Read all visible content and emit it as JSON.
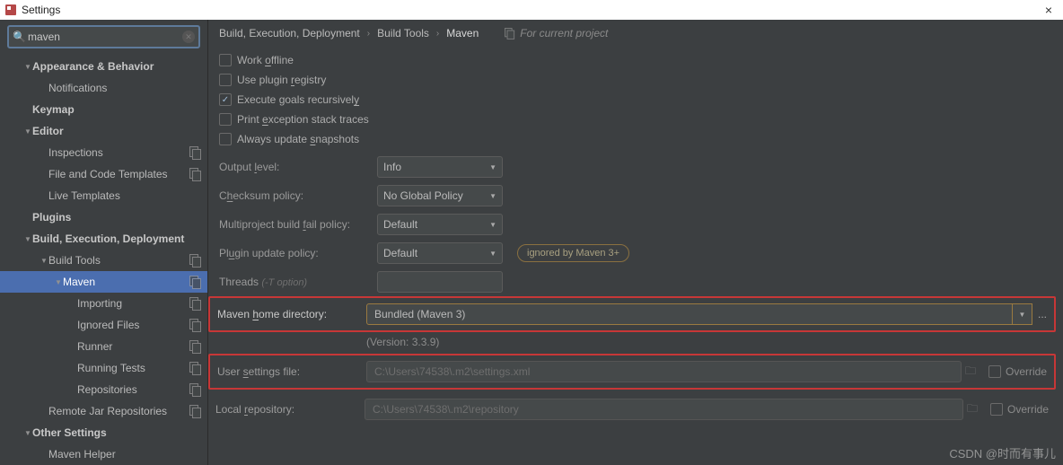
{
  "window": {
    "title": "Settings",
    "close": "×"
  },
  "search": {
    "value": "maven"
  },
  "sidebar": [
    {
      "label": "Appearance & Behavior",
      "depth": 1,
      "arrow": "▼",
      "bold": true
    },
    {
      "label": "Notifications",
      "depth": 2
    },
    {
      "label": "Keymap",
      "depth": 1,
      "bold": true
    },
    {
      "label": "Editor",
      "depth": 1,
      "arrow": "▼",
      "bold": true
    },
    {
      "label": "Inspections",
      "depth": 2,
      "icon": true
    },
    {
      "label": "File and Code Templates",
      "depth": 2,
      "icon": true
    },
    {
      "label": "Live Templates",
      "depth": 2
    },
    {
      "label": "Plugins",
      "depth": 1,
      "bold": true
    },
    {
      "label": "Build, Execution, Deployment",
      "depth": 1,
      "arrow": "▼",
      "bold": true
    },
    {
      "label": "Build Tools",
      "depth": 2,
      "arrow": "▼",
      "icon": true
    },
    {
      "label": "Maven",
      "depth": 3,
      "arrow": "▼",
      "icon": true,
      "sel": true
    },
    {
      "label": "Importing",
      "depth": 4,
      "icon": true
    },
    {
      "label": "Ignored Files",
      "depth": 4,
      "icon": true
    },
    {
      "label": "Runner",
      "depth": 4,
      "icon": true
    },
    {
      "label": "Running Tests",
      "depth": 4,
      "icon": true
    },
    {
      "label": "Repositories",
      "depth": 4,
      "icon": true
    },
    {
      "label": "Remote Jar Repositories",
      "depth": 2,
      "icon": true
    },
    {
      "label": "Other Settings",
      "depth": 1,
      "arrow": "▼",
      "bold": true
    },
    {
      "label": "Maven Helper",
      "depth": 2
    }
  ],
  "breadcrumb": {
    "a": "Build, Execution, Deployment",
    "b": "Build Tools",
    "c": "Maven",
    "proj": "For current project"
  },
  "checks": [
    {
      "pre": "Work ",
      "u": "o",
      "post": "ffline",
      "checked": false
    },
    {
      "pre": "Use plugin ",
      "u": "r",
      "post": "egistry",
      "checked": false
    },
    {
      "pre": "Execute goals recursivel",
      "u": "y",
      "post": "",
      "checked": true
    },
    {
      "pre": "Print ",
      "u": "e",
      "post": "xception stack traces",
      "checked": false
    },
    {
      "pre": "Always update ",
      "u": "s",
      "post": "napshots",
      "checked": false
    }
  ],
  "fields": {
    "output": {
      "pre": "Output ",
      "u": "l",
      "post": "evel:",
      "value": "Info"
    },
    "checksum": {
      "pre": "C",
      "u": "h",
      "post": "ecksum policy:",
      "value": "No Global Policy"
    },
    "multiproject": {
      "pre": "Multiproject build ",
      "u": "f",
      "post": "ail policy:",
      "value": "Default"
    },
    "plugin": {
      "pre": "Pl",
      "u": "u",
      "post": "gin update policy:",
      "value": "Default",
      "badge": "ignored by Maven 3+"
    },
    "threads": {
      "label": "Threads ",
      "note": "(-T option)"
    }
  },
  "maven_home": {
    "pre": "Maven ",
    "u": "h",
    "post": "ome directory:",
    "value": "Bundled (Maven 3)",
    "version": "(Version: 3.3.9)"
  },
  "user_settings": {
    "pre": "User ",
    "u": "s",
    "post": "ettings file:",
    "value": "C:\\Users\\74538\\.m2\\settings.xml",
    "override": "Override"
  },
  "local_repo": {
    "pre": "Local ",
    "u": "r",
    "post": "epository:",
    "value": "C:\\Users\\74538\\.m2\\repository",
    "override": "Override"
  },
  "watermark": "CSDN @时而有事儿"
}
